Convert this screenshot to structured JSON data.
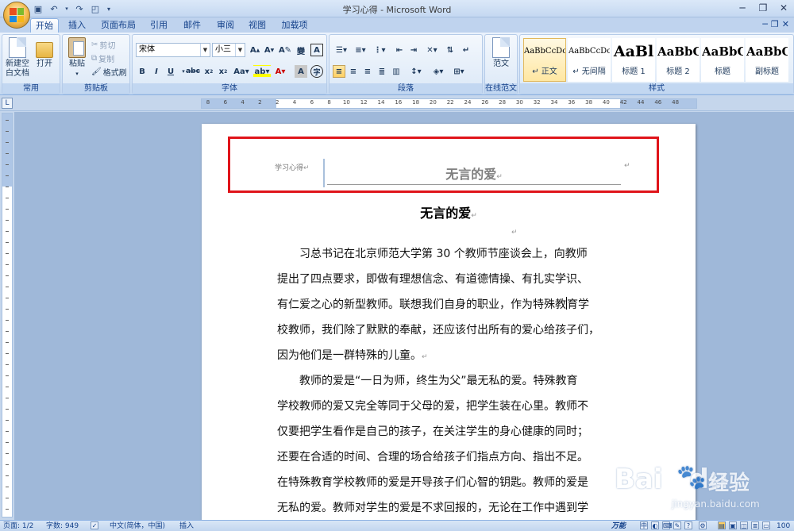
{
  "window": {
    "title": "学习心得 - Microsoft Word"
  },
  "qat": {
    "save_icon": "save-icon",
    "undo_icon": "undo-icon",
    "redo_icon": "redo-icon"
  },
  "tabs": [
    {
      "label": "开始",
      "active": true
    },
    {
      "label": "插入"
    },
    {
      "label": "页面布局"
    },
    {
      "label": "引用"
    },
    {
      "label": "邮件"
    },
    {
      "label": "审阅"
    },
    {
      "label": "视图"
    },
    {
      "label": "加载项"
    }
  ],
  "ribbon": {
    "common": {
      "label": "常用",
      "new_doc": "新建空\n白文档",
      "open": "打开"
    },
    "clipboard": {
      "label": "剪贴板",
      "paste": "粘贴",
      "cut": "剪切",
      "copy": "复制",
      "format_painter": "格式刷"
    },
    "font": {
      "label": "字体",
      "font_name": "宋体",
      "font_size": "小三"
    },
    "paragraph": {
      "label": "段落"
    },
    "model": {
      "label": "在线范文",
      "btn": "范文"
    },
    "styles": {
      "label": "样式",
      "items": [
        {
          "sample": "AaBbCcDc",
          "name": "正文",
          "selected": true
        },
        {
          "sample": "AaBbCcDc",
          "name": "无间隔"
        },
        {
          "sample": "AaBl",
          "name": "标题 1"
        },
        {
          "sample": "AaBbC",
          "name": "标题 2"
        },
        {
          "sample": "AaBbC",
          "name": "标题"
        },
        {
          "sample": "AaBbC",
          "name": "副标题"
        }
      ]
    }
  },
  "ruler": {
    "ticks": [
      "8",
      "6",
      "4",
      "2",
      "2",
      "4",
      "6",
      "8",
      "10",
      "12",
      "14",
      "16",
      "18",
      "20",
      "22",
      "24",
      "26",
      "28",
      "30",
      "32",
      "34",
      "36",
      "38",
      "40",
      "42",
      "44",
      "46",
      "48"
    ]
  },
  "document": {
    "header_label": "学习心得",
    "header_title": "无言的爱",
    "title": "无言的爱",
    "para_mark": "↵",
    "paragraph1": [
      "习总书记在北京师范大学第 30 个教师节座谈会上，向教师",
      "提出了四点要求，即做有理想信念、有道德情操、有扎实学识、",
      "有仁爱之心的新型教师。联想我们自身的职业，作为特殊教",
      "育学",
      "校教师，我们除了默默的奉献，还应该付出所有的爱心给孩子们，",
      "因为他们是一群特殊的儿童。"
    ],
    "paragraph2": [
      "教师的爱是“一日为师，终生为父”最无私的爱。特殊教育",
      "学校教师的爱又完全等同于父母的爱，把学生装在心里。教师不",
      "仅要把学生看作是自己的孩子，在关注学生的身心健康的同时；",
      "还要在合适的时间、合理的场合给孩子们指点方向、指出不足。",
      "在特殊教育学校教师的爱是开导孩子们心智的钥匙。教师的爱是",
      "无私的爱。教师对学生的爱是不求回报的，无论在工作中遇到学"
    ]
  },
  "watermark": {
    "text": "Bai",
    "text2": "du",
    "cn": "经验",
    "url": "jingyan.baidu.com"
  },
  "status": {
    "page": "页面: 1/2",
    "words": "字数: 949",
    "lang": "中文(简体，中国)",
    "mode": "插入",
    "ime": "万能",
    "zoom": "100"
  }
}
